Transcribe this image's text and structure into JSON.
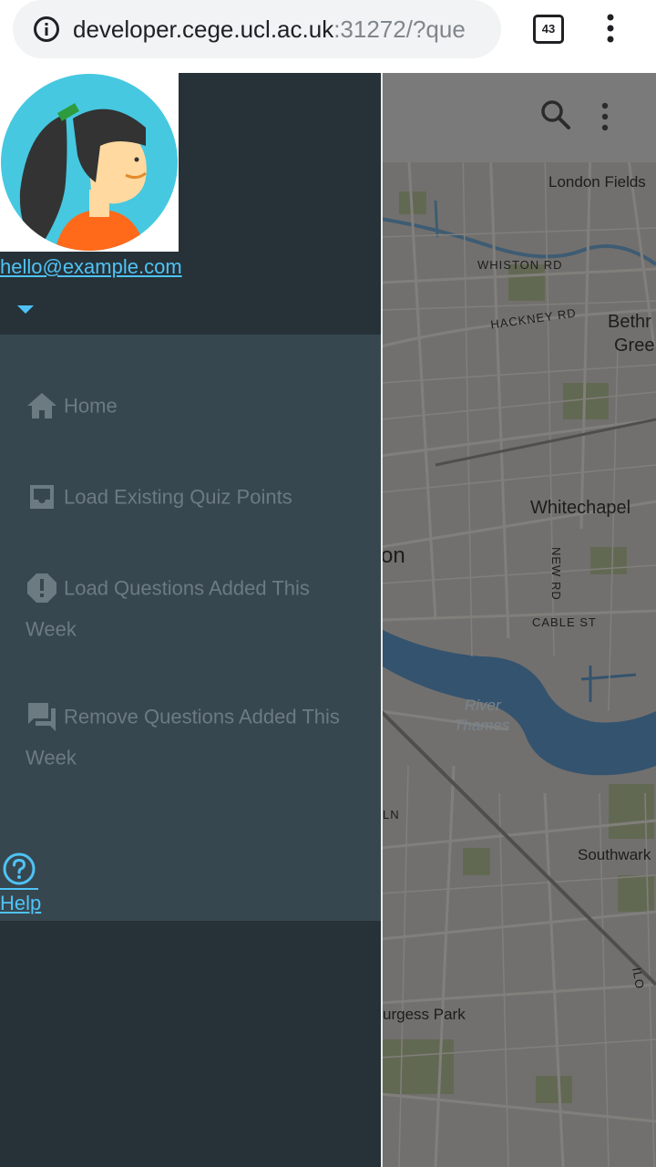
{
  "browser": {
    "url_host": "developer.cege.ucl.ac.uk",
    "url_rest": ":31272/?que",
    "tab_count": "43"
  },
  "map": {
    "labels": {
      "london_fields": "London Fields",
      "whiston_rd": "WHISTON RD",
      "hackney_rd": "HACKNEY RD",
      "bethnal_1": "Bethr",
      "bethnal_2": "Gree",
      "whitechapel": "Whitechapel",
      "new_rd": "NEW RD",
      "london_partial": "on",
      "cable_st": "CABLE ST",
      "river_1": "River",
      "river_2": "Thames",
      "ln": "LN",
      "southwark": "Southwark",
      "burgess_park": "urgess Park",
      "ilo": "ILO"
    }
  },
  "drawer": {
    "email": "hello@example.com",
    "menu": [
      {
        "label": "Home",
        "icon": "home-icon"
      },
      {
        "label": "Load Existing Quiz Points",
        "icon": "inbox-icon"
      },
      {
        "label": "Load Questions Added This Week",
        "icon": "alert-octagon-icon"
      },
      {
        "label": "Remove Questions Added This Week",
        "icon": "forum-icon"
      }
    ],
    "help_label": "Help"
  },
  "colors": {
    "drawer_bg": "#263238",
    "menu_bg": "#37474f",
    "accent": "#4fc3f7",
    "menu_text": "#6c7b82"
  }
}
